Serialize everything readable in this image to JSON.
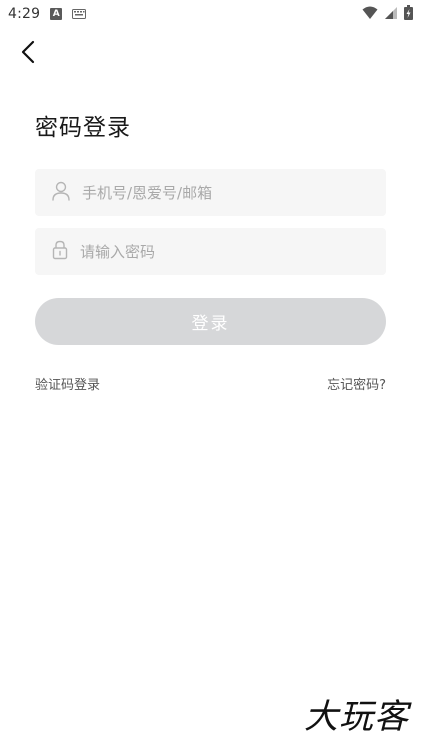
{
  "status_bar": {
    "time": "4:29",
    "notification_letter": "A"
  },
  "page": {
    "title": "密码登录"
  },
  "form": {
    "account_placeholder": "手机号/恩爱号/邮箱",
    "password_placeholder": "请输入密码",
    "login_label": "登录"
  },
  "links": {
    "sms_login": "验证码登录",
    "forgot_password": "忘记密码?"
  },
  "watermark": {
    "text": "大玩客"
  },
  "colors": {
    "button_disabled": "#d6d7d9",
    "field_background": "#f6f6f6",
    "placeholder": "#a9a9a9"
  }
}
